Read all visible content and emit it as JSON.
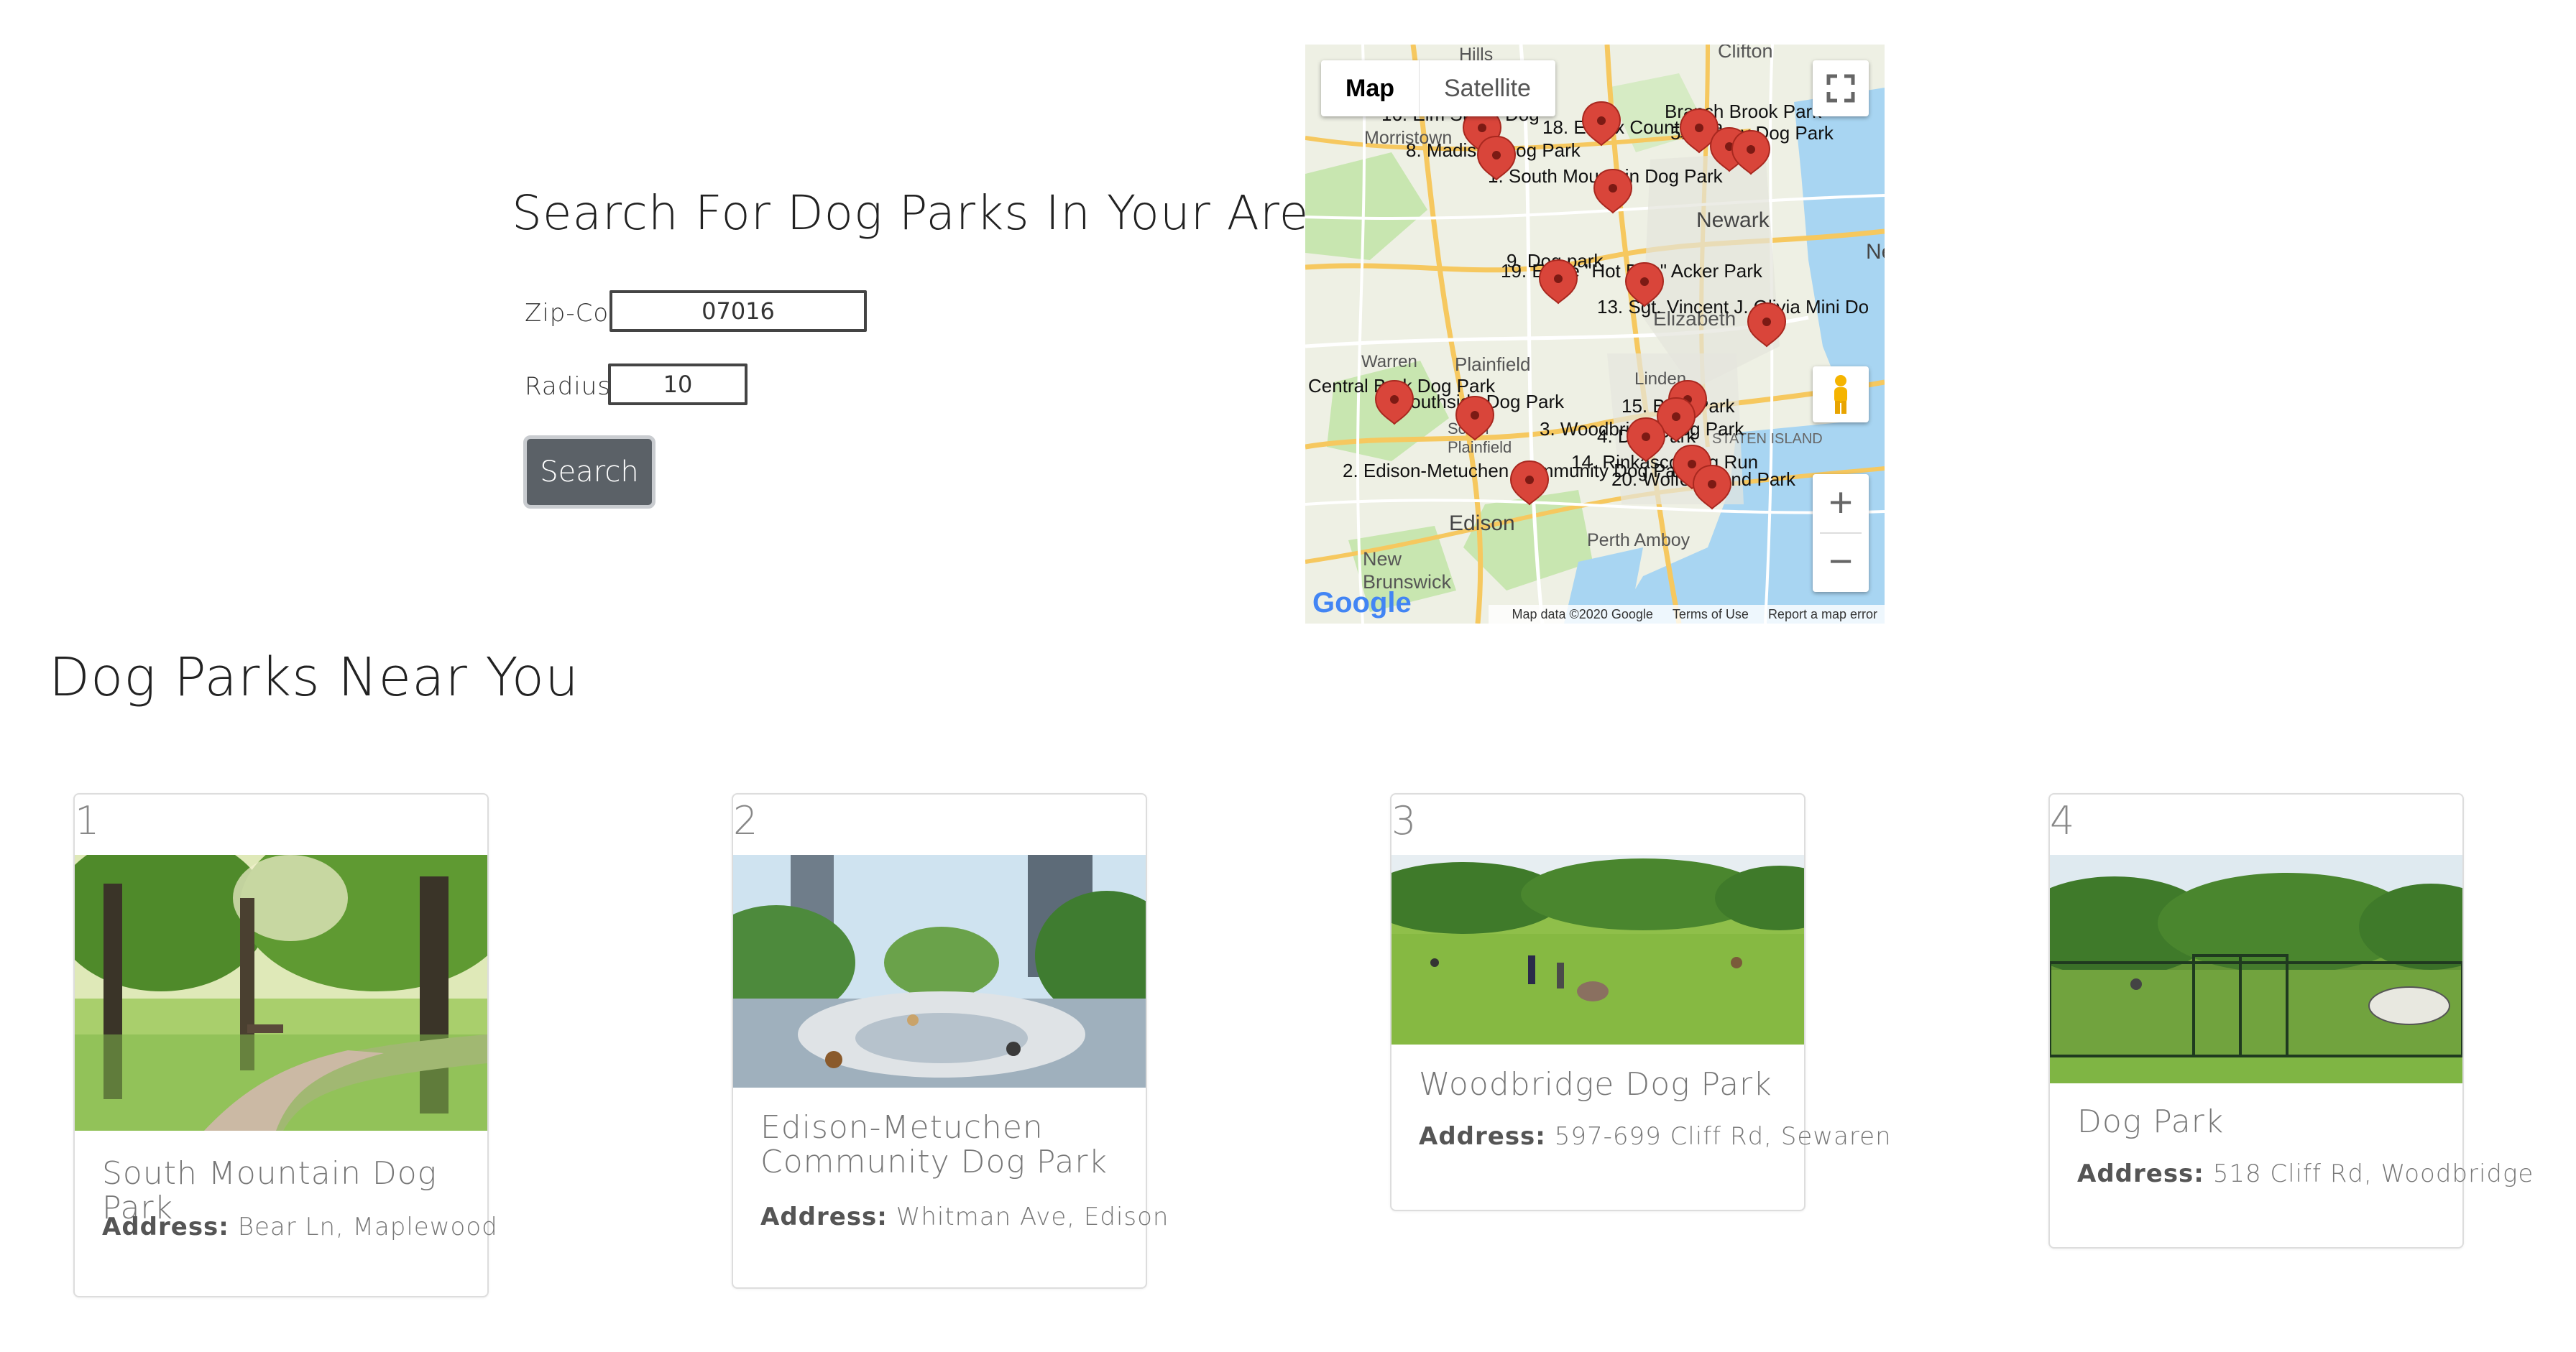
{
  "search": {
    "title": "Search For Dog Parks In Your Area",
    "zip_label": "Zip-Code:",
    "zip_value": "07016",
    "radius_label": "Radius:",
    "radius_value": "10",
    "button_label": "Search"
  },
  "map": {
    "type_map": "Map",
    "type_satellite": "Satellite",
    "zoom_in": "+",
    "zoom_out": "−",
    "logo": "Google",
    "footer_data": "Map data ©2020 Google",
    "footer_terms": "Terms of Use",
    "footer_report": "Report a map error",
    "towns": [
      "Clifton",
      "Morristown",
      "Newark",
      "Elizabeth",
      "Plainfield",
      "Edison",
      "Perth Amboy",
      "New Brunswick",
      "Warren",
      "South Plainfield",
      "Linden",
      "STATEN ISLAND",
      "Ne",
      "Hills"
    ],
    "marker_labels": [
      "16. Elm Street Dog",
      "Branch Brook Park",
      "18. Essex County Bra",
      "5. Kearny Dog Park",
      "8. Madison Dog Park",
      "1. South Mountain Dog Park",
      "9. Dog park",
      "19. Eagle \"Hot Dog\" Acker Park",
      "13. Sgt. Vincent J. Olivia Mini Do",
      "Central Bark Dog Park",
      "7. Southside Dog Park",
      "15. Bark Park",
      "3. Woodbridge Dog Park",
      "4. Dog Park",
      "14. Rinkasco Dog Run",
      "2. Edison-Metuchen Community Dog Park",
      "20. Wolfe's Pond Park"
    ]
  },
  "results": {
    "title": "Dog Parks Near You",
    "address_label": "Address:",
    "cards": [
      {
        "num": "1",
        "name": "South Mountain Dog Park",
        "address": "Bear Ln, Maplewood"
      },
      {
        "num": "2",
        "name": "Edison-Metuchen Community Dog Park",
        "address": "Whitman Ave, Edison"
      },
      {
        "num": "3",
        "name": "Woodbridge Dog Park",
        "address": "597-699 Cliff Rd, Sewaren"
      },
      {
        "num": "4",
        "name": "Dog Park",
        "address": "518 Cliff Rd, Woodbridge"
      }
    ]
  },
  "colors": {
    "button": "#5b6167",
    "marker": "#d9453a",
    "park_green": "#c8e6b0",
    "water": "#a8d5f2"
  }
}
